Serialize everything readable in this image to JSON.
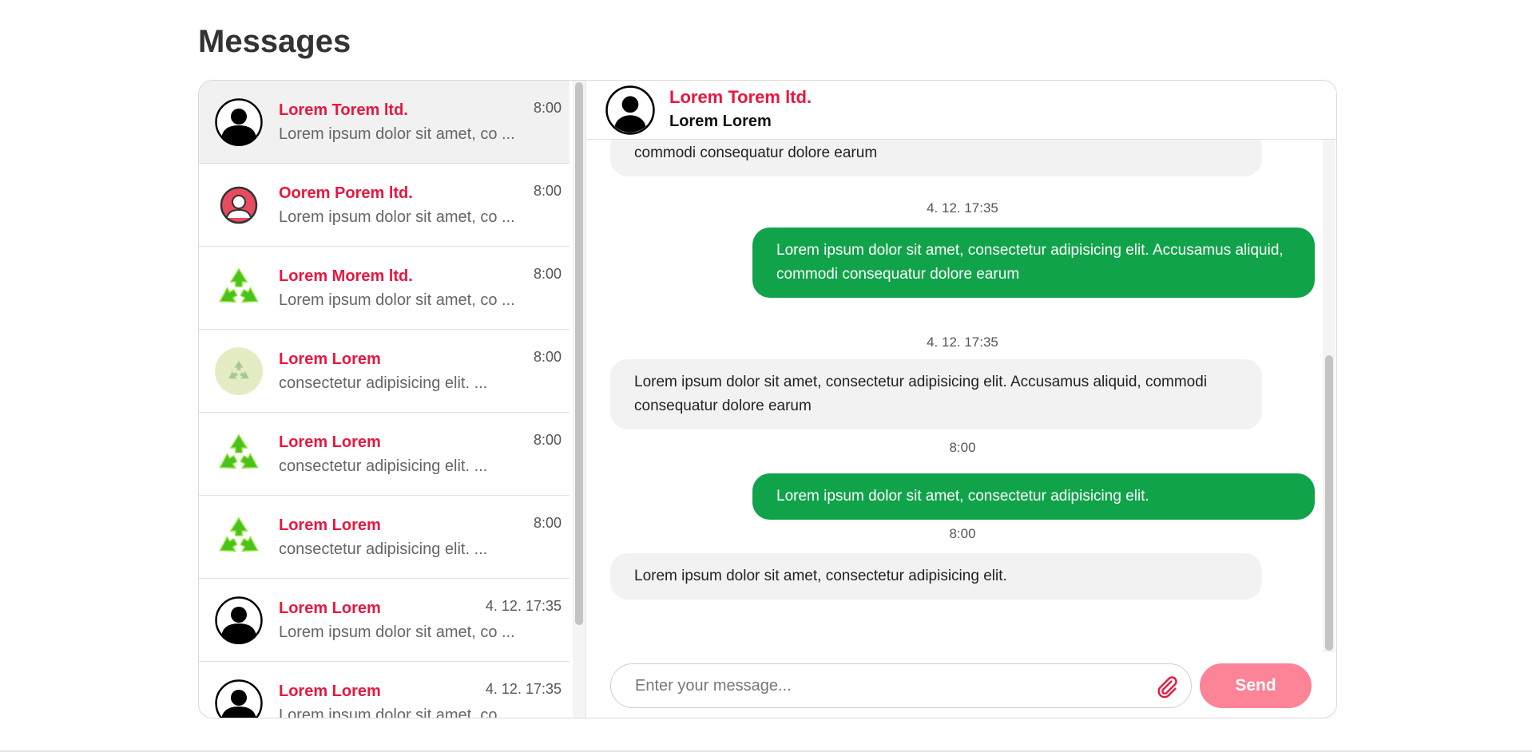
{
  "page": {
    "title": "Messages"
  },
  "conversations": [
    {
      "name": "Lorem Torem ltd.",
      "time": "8:00",
      "preview": "Lorem ipsum dolor sit amet, co ...",
      "avatar": "person-silhouette-icon",
      "active": true
    },
    {
      "name": "Oorem Porem ltd.",
      "time": "8:00",
      "preview": "Lorem ipsum dolor sit amet, co ...",
      "avatar": "user-circle-red-icon"
    },
    {
      "name": "Lorem Morem ltd.",
      "time": "8:00",
      "preview": "Lorem ipsum dolor sit amet, co ...",
      "avatar": "recycle-icon"
    },
    {
      "name": "Lorem Lorem",
      "time": "8:00",
      "preview": "consectetur adipisicing elit. ...",
      "avatar": "recycle-faded-icon"
    },
    {
      "name": "Lorem Lorem",
      "time": "8:00",
      "preview": "consectetur adipisicing elit. ...",
      "avatar": "recycle-icon"
    },
    {
      "name": "Lorem Lorem",
      "time": "8:00",
      "preview": "consectetur adipisicing elit. ...",
      "avatar": "recycle-icon"
    },
    {
      "name": "Lorem Lorem",
      "time": "4. 12. 17:35",
      "preview": "Lorem ipsum dolor sit amet, co ...",
      "avatar": "person-silhouette-icon"
    },
    {
      "name": "Lorem Lorem",
      "time": "4. 12. 17:35",
      "preview": "Lorem ipsum dolor sit amet, co ...",
      "avatar": "person-silhouette-icon"
    }
  ],
  "chat": {
    "company": "Lorem Torem ltd.",
    "contact": "Lorem Lorem",
    "messages": [
      {
        "type": "in",
        "text": "commodi consequatur dolore earum"
      },
      {
        "type": "stamp",
        "text": "4. 12. 17:35"
      },
      {
        "type": "out",
        "text": "Lorem ipsum dolor sit amet, consectetur adipisicing elit. Accusamus aliquid, commodi consequatur dolore earum"
      },
      {
        "type": "stamp",
        "text": "4. 12. 17:35"
      },
      {
        "type": "in",
        "text": "Lorem ipsum dolor sit amet, consectetur adipisicing elit. Accusamus aliquid, commodi consequatur dolore earum"
      },
      {
        "type": "stamp",
        "text": "8:00"
      },
      {
        "type": "out",
        "text": "Lorem ipsum dolor sit amet, consectetur adipisicing elit."
      },
      {
        "type": "stamp",
        "text": "8:00"
      },
      {
        "type": "in",
        "text": "Lorem ipsum dolor sit amet, consectetur adipisicing elit."
      }
    ]
  },
  "composer": {
    "placeholder": "Enter your message...",
    "value": "",
    "send_label": "Send",
    "attach_icon": "paperclip-icon"
  },
  "colors": {
    "accent_red": "#e8173f",
    "send_button": "#fd8396",
    "outgoing_bubble": "#11a34a",
    "incoming_bubble": "#f2f2f2"
  }
}
